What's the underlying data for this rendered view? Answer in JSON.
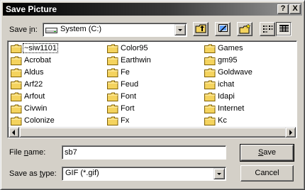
{
  "window": {
    "title": "Save Picture",
    "help_label": "?",
    "close_label": "X"
  },
  "save_in": {
    "label_pre": "Save ",
    "label_key": "i",
    "label_post": "n:",
    "value": "System (C:)"
  },
  "toolbar": {
    "icons": [
      "up-one-level-icon",
      "desktop-icon",
      "create-new-folder-icon",
      "list-view-icon",
      "details-view-icon"
    ],
    "active_view": "details-view"
  },
  "files": {
    "columns": [
      [
        "~siw1101",
        "Acrobat",
        "Aldus",
        "Arf22",
        "Arfout",
        "Civwin",
        "Colonize"
      ],
      [
        "Color95",
        "Earthwin",
        "Fe",
        "Feud",
        "Font",
        "Fort",
        "Fx"
      ],
      [
        "Games",
        "gm95",
        "Goldwave",
        "ichat",
        "Idapi",
        "Internet",
        "Kc"
      ]
    ],
    "selected": "~siw1101",
    "folder_color": "#f4d35e"
  },
  "file_name": {
    "label_pre": "File ",
    "label_key": "n",
    "label_post": "ame:",
    "value": "sb7"
  },
  "save_as_type": {
    "label_pre": "Save as ",
    "label_key": "t",
    "label_post": "ype:",
    "value": "GIF (*.gif)"
  },
  "buttons": {
    "save_key": "S",
    "save_rest": "ave",
    "cancel": "Cancel"
  }
}
